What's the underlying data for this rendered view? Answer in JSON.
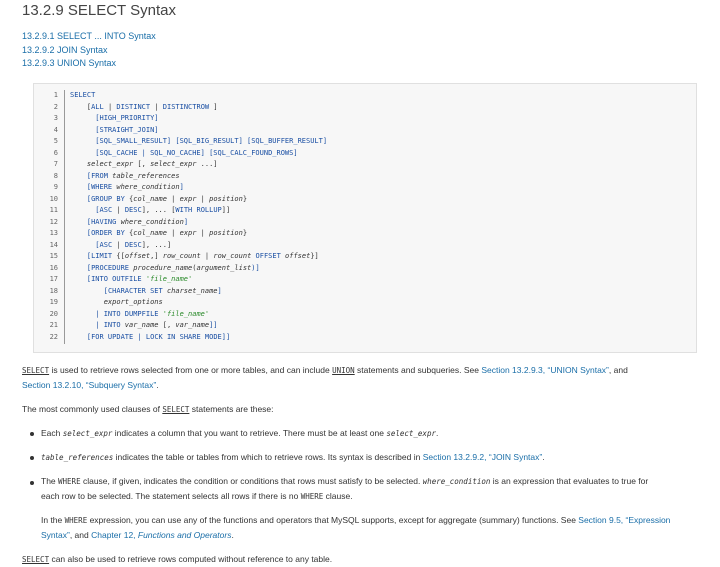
{
  "title": "13.2.9 SELECT Syntax",
  "toc": [
    "13.2.9.1 SELECT ... INTO Syntax",
    "13.2.9.2 JOIN Syntax",
    "13.2.9.3 UNION Syntax"
  ],
  "line_numbers": [
    "1",
    "2",
    "3",
    "4",
    "5",
    "6",
    "7",
    "8",
    "9",
    "10",
    "11",
    "12",
    "13",
    "14",
    "15",
    "16",
    "17",
    "18",
    "19",
    "20",
    "21",
    "22"
  ],
  "code": {
    "l1": "SELECT",
    "l2a": "    [",
    "l2b": "ALL",
    "l2c": " | ",
    "l2d": "DISTINCT",
    "l2e": " | ",
    "l2f": "DISTINCTROW",
    "l2g": " ]",
    "l3": "      [HIGH_PRIORITY]",
    "l4": "      [STRAIGHT_JOIN]",
    "l5": "      [SQL_SMALL_RESULT] [SQL_BIG_RESULT] [SQL_BUFFER_RESULT]",
    "l6": "      [SQL_CACHE | SQL_NO_CACHE] [SQL_CALC_FOUND_ROWS]",
    "l7a": "    ",
    "l7b": "select_expr",
    "l7c": " [, ",
    "l7d": "select_expr",
    "l7e": " ...]",
    "l8a": "    [",
    "l8b": "FROM",
    "l8c": " ",
    "l8d": "table_references",
    "l9a": "    [",
    "l9b": "WHERE",
    "l9c": " ",
    "l9d": "where_condition",
    "l9e": "]",
    "l10a": "    [",
    "l10b": "GROUP BY",
    "l10c": " {",
    "l10d": "col_name",
    "l10e": " | ",
    "l10f": "expr",
    "l10g": " | ",
    "l10h": "position",
    "l10i": "}",
    "l11a": "      [",
    "l11b": "ASC",
    "l11c": " | ",
    "l11d": "DESC",
    "l11e": "], ... [",
    "l11f": "WITH ROLLUP",
    "l11g": "]]",
    "l12a": "    [",
    "l12b": "HAVING",
    "l12c": " ",
    "l12d": "where_condition",
    "l12e": "]",
    "l13a": "    [",
    "l13b": "ORDER BY",
    "l13c": " {",
    "l13d": "col_name",
    "l13e": " | ",
    "l13f": "expr",
    "l13g": " | ",
    "l13h": "position",
    "l13i": "}",
    "l14a": "      [",
    "l14b": "ASC",
    "l14c": " | ",
    "l14d": "DESC",
    "l14e": "], ...]",
    "l15a": "    [",
    "l15b": "LIMIT",
    "l15c": " {[",
    "l15d": "offset",
    "l15e": ",] ",
    "l15f": "row_count",
    "l15g": " | ",
    "l15h": "row_count",
    "l15i": " ",
    "l15j": "OFFSET",
    "l15k": " ",
    "l15l": "offset",
    "l15m": "}]",
    "l16a": "    [",
    "l16b": "PROCEDURE",
    "l16c": " ",
    "l16d": "procedure_name",
    "l16e": "(",
    "l16f": "argument_list",
    "l16g": ")]",
    "l17a": "    [",
    "l17b": "INTO OUTFILE",
    "l17c": " ",
    "l17d": "'file_name'",
    "l18a": "        [",
    "l18b": "CHARACTER SET",
    "l18c": " ",
    "l18d": "charset_name",
    "l18e": "]",
    "l19a": "        ",
    "l19b": "export_options",
    "l20a": "      | ",
    "l20b": "INTO DUMPFILE",
    "l20c": " ",
    "l20d": "'file_name'",
    "l21a": "      | ",
    "l21b": "INTO",
    "l21c": " ",
    "l21d": "var_name",
    "l21e": " [, ",
    "l21f": "var_name",
    "l21g": "]]",
    "l22a": "    [",
    "l22b": "FOR UPDATE",
    "l22c": " | ",
    "l22d": "LOCK IN SHARE MODE",
    "l22e": "]]"
  },
  "p1": {
    "a": "SELECT",
    "b": " is used to retrieve rows selected from one or more tables, and can include ",
    "c": "UNION",
    "d": " statements and subqueries. See ",
    "e": "Section 13.2.9.3, “UNION Syntax”",
    "f": ", and",
    "g": "Section 13.2.10, “Subquery Syntax”",
    "h": "."
  },
  "p2": {
    "a": "The most commonly used clauses of ",
    "b": "SELECT",
    "c": " statements are these:"
  },
  "b1": {
    "a": "Each ",
    "b": "select_expr",
    "c": " indicates a column that you want to retrieve. There must be at least one ",
    "d": "select_expr",
    "e": "."
  },
  "b2": {
    "a": "table_references",
    "b": " indicates the table or tables from which to retrieve rows. Its syntax is described in ",
    "c": "Section 13.2.9.2, “JOIN Syntax”",
    "d": "."
  },
  "b3": {
    "a": "The ",
    "b": "WHERE",
    "c": " clause, if given, indicates the condition or conditions that rows must satisfy to be selected. ",
    "d": "where_condition",
    "e": " is an expression that evaluates to true for",
    "f": "each row to be selected. The statement selects all rows if there is no ",
    "g": "WHERE",
    "h": " clause."
  },
  "b3p": {
    "a": "In the ",
    "b": "WHERE",
    "c": " expression, you can use any of the functions and operators that MySQL supports, except for aggregate (summary) functions. See ",
    "d": "Section 9.5, “Expression",
    "e": "Syntax”",
    "f": ", and ",
    "g": "Chapter 12, ",
    "h": "Functions and Operators",
    "i": "."
  },
  "p3": {
    "a": "SELECT",
    "b": " can also be used to retrieve rows computed without reference to any table."
  }
}
